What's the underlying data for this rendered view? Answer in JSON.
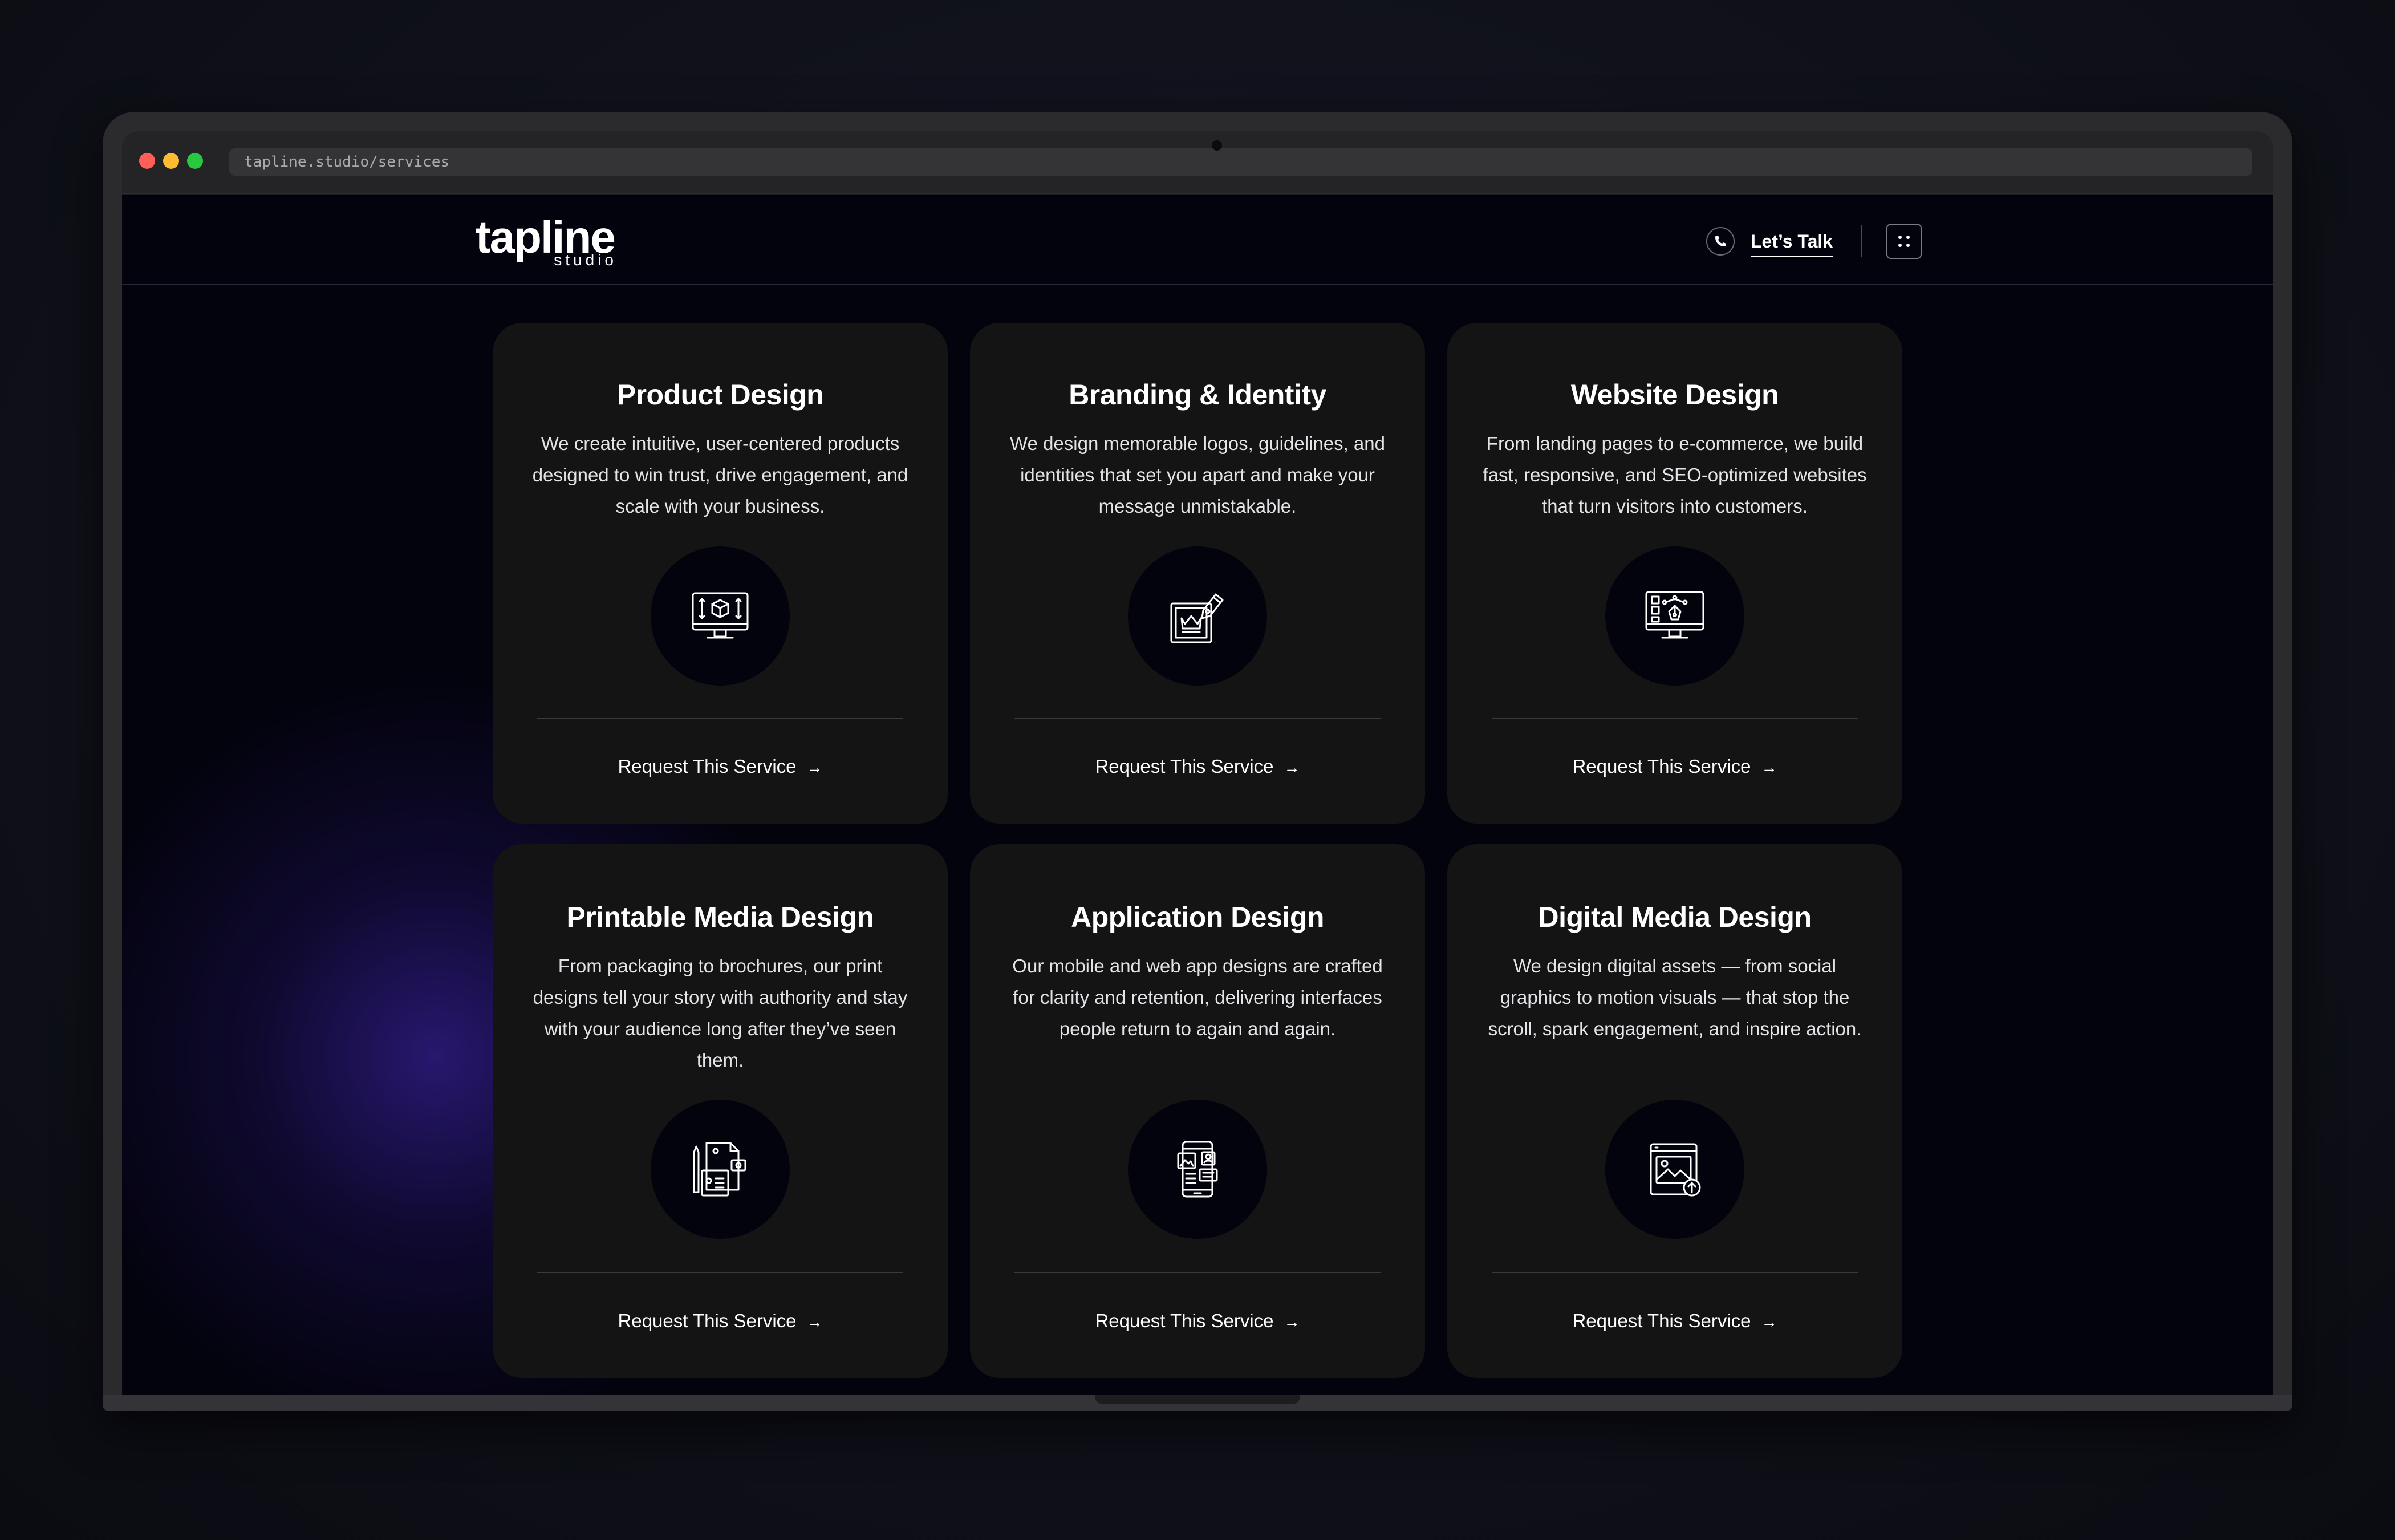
{
  "browser": {
    "url": "tapline.studio/services"
  },
  "header": {
    "logo_main": "tapline",
    "logo_sub": "studio",
    "cta_label": "Let’s Talk"
  },
  "services": [
    {
      "title": "Product Design",
      "description": "We create intuitive, user-centered products designed to win trust, drive engagement, and scale with your business.",
      "icon": "monitor-cube-icon",
      "cta": "Request This Service"
    },
    {
      "title": "Branding & Identity",
      "description": "We design memorable logos, guidelines, and identities that set you apart and make your message unmistakable.",
      "icon": "pen-crown-icon",
      "cta": "Request This Service"
    },
    {
      "title": "Website Design",
      "description": "From landing pages to e-commerce, we build fast, responsive, and SEO-optimized websites that turn visitors into customers.",
      "icon": "monitor-pen-tool-icon",
      "cta": "Request This Service"
    },
    {
      "title": "Printable Media Design",
      "description": "From packaging to brochures, our print designs tell your story with authority and stay with your audience long after they’ve seen them.",
      "icon": "print-media-icon",
      "cta": "Request This Service"
    },
    {
      "title": "Application Design",
      "description": "Our mobile and web app designs are crafted for clarity and retention, delivering interfaces people return to again and again.",
      "icon": "mobile-app-icon",
      "cta": "Request This Service"
    },
    {
      "title": "Digital Media Design",
      "description": "We design digital assets — from social graphics to motion visuals — that stop the scroll, spark engagement, and inspire action.",
      "icon": "image-upload-icon",
      "cta": "Request This Service"
    }
  ],
  "colors": {
    "page_background": "#03030e",
    "card_background": "#141414",
    "accent_glow": "#3b22a8",
    "text": "#ffffff"
  }
}
